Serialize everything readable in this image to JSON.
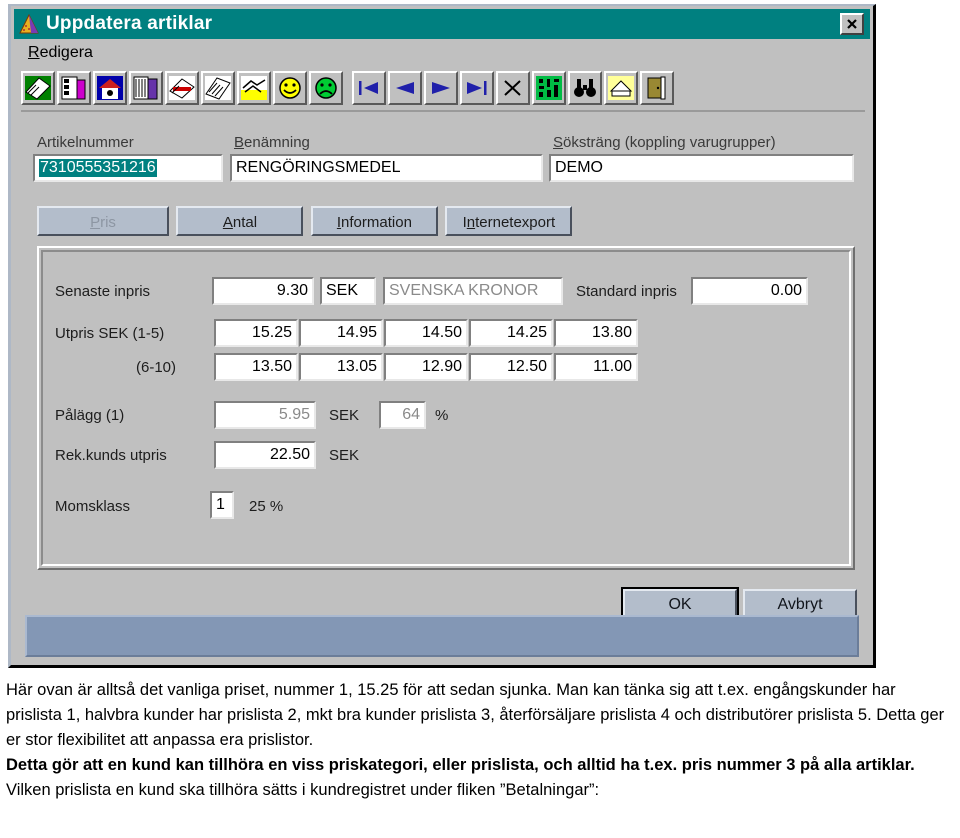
{
  "window": {
    "title": "Uppdatera artiklar",
    "title_icon": "pyramid-icon",
    "close_label": "×"
  },
  "menu": {
    "items": [
      {
        "label": "Redigera",
        "accel": "R"
      }
    ]
  },
  "toolbar": {
    "buttons": [
      {
        "name": "new-article-icon",
        "glyph": ""
      },
      {
        "name": "copy-article-icon",
        "glyph": ""
      },
      {
        "name": "supplier-icon",
        "glyph": ""
      },
      {
        "name": "warehouse-icon",
        "glyph": ""
      },
      {
        "name": "delete-article-icon",
        "glyph": ""
      },
      {
        "name": "notes-icon",
        "glyph": ""
      },
      {
        "name": "handshake-icon",
        "glyph": ""
      },
      {
        "name": "smiley-happy-icon",
        "glyph": "☺"
      },
      {
        "name": "smiley-sad-icon",
        "glyph": "☹"
      },
      {
        "name": "first-record-icon",
        "glyph": ""
      },
      {
        "name": "previous-record-icon",
        "glyph": ""
      },
      {
        "name": "next-record-icon",
        "glyph": ""
      },
      {
        "name": "last-record-icon",
        "glyph": ""
      },
      {
        "name": "cancel-x-icon",
        "glyph": ""
      },
      {
        "name": "barcode-icon",
        "glyph": ""
      },
      {
        "name": "find-binoculars-icon",
        "glyph": ""
      },
      {
        "name": "note-yellow-icon",
        "glyph": ""
      },
      {
        "name": "exit-door-icon",
        "glyph": ""
      }
    ]
  },
  "fields": {
    "article_number": {
      "label": "Artikelnummer",
      "accel": "A",
      "value": "7310555351216",
      "selected": true
    },
    "description": {
      "label": "Benämning",
      "accel": "B",
      "value": "RENGÖRINGSMEDEL"
    },
    "search_string": {
      "label": "Söksträng (koppling varugrupper)",
      "accel": "S",
      "value": "DEMO"
    }
  },
  "tabs": [
    {
      "label": "Pris",
      "accel": "P",
      "active": true
    },
    {
      "label": "Antal",
      "accel": "A",
      "active": false
    },
    {
      "label": "Information",
      "accel": "I",
      "active": false
    },
    {
      "label": "Internetexport",
      "accel": "n",
      "active": false
    }
  ],
  "price_panel": {
    "latest_in_price": {
      "label": "Senaste inpris",
      "value": "9.30",
      "currency_code": "SEK",
      "currency_name": "SVENSKA KRONOR"
    },
    "standard_in_price": {
      "label": "Standard inpris",
      "value": "0.00"
    },
    "out_price_1_5": {
      "label": "Utpris SEK (1-5)",
      "values": [
        "15.25",
        "14.95",
        "14.50",
        "14.25",
        "13.80"
      ]
    },
    "out_price_6_10": {
      "label": "(6-10)",
      "values": [
        "13.50",
        "13.05",
        "12.90",
        "12.50",
        "11.00"
      ]
    },
    "markup": {
      "label": "Pålägg (1)",
      "value": "5.95",
      "currency_code": "SEK",
      "percent_value": "64",
      "percent_symbol": "%"
    },
    "recommended_price": {
      "label": "Rek.kunds utpris",
      "value": "22.50",
      "currency_code": "SEK"
    },
    "vat_class": {
      "label": "Momsklass",
      "value": "1",
      "rate": "25 %"
    }
  },
  "dialog_buttons": {
    "ok": "OK",
    "cancel": "Avbryt"
  },
  "body_text": {
    "p1_a": "Här ovan är alltså det vanliga priset, nummer 1, 15.25 för att sedan sjunka. Man kan tänka sig att t.ex. engångskunder har prislista 1, halvbra kunder har prislista 2, mkt bra kunder prislista 3, återförsäljare prislista 4 och distributörer prislista 5. Detta ger er stor flexibilitet att anpassa era prislistor.",
    "p2_bold": "Detta gör att en kund kan tillhöra en viss priskategori, eller prislista, och alltid ha t.ex. pris nummer 3 på alla artiklar.",
    "p2_rest": " Vilken prislista en kund ska tillhöra sätts i kundregistret under fliken ”Betalningar”:"
  },
  "colors": {
    "titlebar": "#008080",
    "window_face": "#c0c0c0",
    "button_face": "#b3bdcb",
    "selection": "#008080",
    "blue_strip": "#8397b5"
  }
}
